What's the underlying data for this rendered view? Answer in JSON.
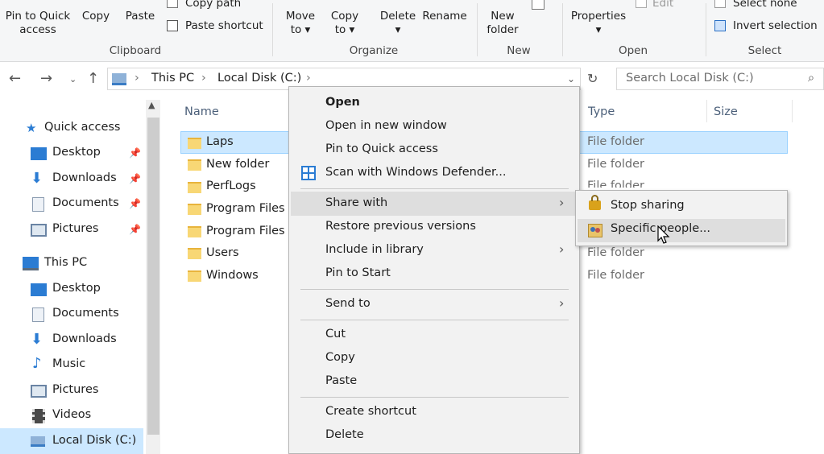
{
  "ribbon": {
    "clipboard": {
      "pin_label": "Pin to Quick\naccess",
      "copy_label": "Copy",
      "paste_label": "Paste",
      "copy_path": "Copy path",
      "paste_shortcut": "Paste shortcut",
      "group": "Clipboard"
    },
    "organize": {
      "move_label": "Move\nto ▾",
      "copyto_label": "Copy\nto ▾",
      "delete_label": "Delete\n▾",
      "rename_label": "Rename",
      "group": "Organize"
    },
    "new": {
      "newfolder_label": "New\nfolder",
      "group": "New"
    },
    "open": {
      "properties_label": "Properties\n▾",
      "edit_label": "Edit",
      "group": "Open"
    },
    "select": {
      "select_none": "Select none",
      "invert_selection": "Invert selection",
      "group": "Select"
    }
  },
  "address": {
    "crumbs": [
      "This PC",
      "Local Disk (C:)"
    ],
    "search_placeholder": "Search Local Disk (C:)"
  },
  "nav": {
    "quick_access": "Quick access",
    "quick_items": [
      "Desktop",
      "Downloads",
      "Documents",
      "Pictures"
    ],
    "this_pc": "This PC",
    "pc_items": [
      "Desktop",
      "Documents",
      "Downloads",
      "Music",
      "Pictures",
      "Videos",
      "Local Disk (C:)"
    ]
  },
  "columns": {
    "name": "Name",
    "type": "Type",
    "size": "Size"
  },
  "files": [
    {
      "name": "Laps",
      "type": "File folder"
    },
    {
      "name": "New folder",
      "type": "File folder"
    },
    {
      "name": "PerfLogs",
      "type": "File folder"
    },
    {
      "name": "Program Files",
      "type": ""
    },
    {
      "name": "Program Files (",
      "type": ""
    },
    {
      "name": "Users",
      "type": "File folder"
    },
    {
      "name": "Windows",
      "type": "File folder"
    }
  ],
  "context_menu": {
    "open": "Open",
    "open_new_window": "Open in new window",
    "pin_quick": "Pin to Quick access",
    "scan": "Scan with Windows Defender...",
    "share_with": "Share with",
    "restore": "Restore previous versions",
    "include_library": "Include in library",
    "pin_start": "Pin to Start",
    "send_to": "Send to",
    "cut": "Cut",
    "copy": "Copy",
    "paste": "Paste",
    "create_shortcut": "Create shortcut",
    "delete": "Delete"
  },
  "share_submenu": {
    "stop_sharing": "Stop sharing",
    "specific_people": "Specific people..."
  }
}
